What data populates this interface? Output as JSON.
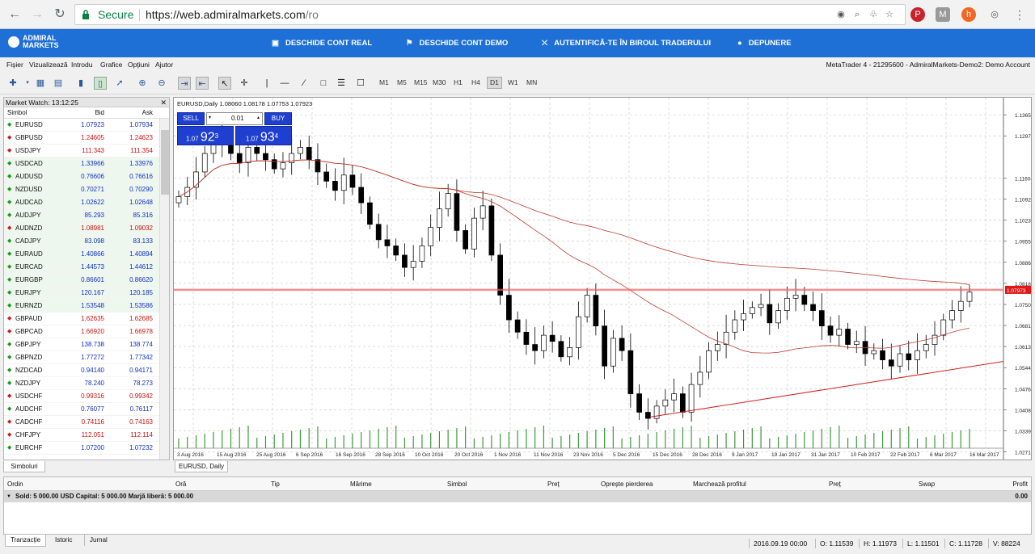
{
  "browser": {
    "secure_label": "Secure",
    "url_main": "https://web.admiralmarkets.com",
    "url_path": "/ro"
  },
  "brand": {
    "logo_line1": "ADMIRAL",
    "logo_line2": "MARKETS",
    "nav": [
      {
        "label": "DESCHIDE CONT REAL"
      },
      {
        "label": "DESCHIDE CONT DEMO"
      },
      {
        "label": "AUTENTIFICĂ-TE ÎN BIROUL TRADERULUI"
      },
      {
        "label": "DEPUNERE"
      }
    ]
  },
  "menu": {
    "items": [
      "Fișier",
      "Vizualizează",
      "Introdu",
      "Grafice",
      "Opțiuni",
      "Ajutor"
    ],
    "account": "MetaTrader 4 - 21295600 - AdmiralMarkets-Demo2: Demo Account"
  },
  "toolbar": {
    "timeframes": [
      "M1",
      "M5",
      "M15",
      "M30",
      "H1",
      "H4",
      "D1",
      "W1",
      "MN"
    ],
    "active_timeframe": "D1"
  },
  "market_watch": {
    "title": "Market Watch: 13:12:25",
    "col_symbol": "Simbol",
    "col_bid": "Bid",
    "col_ask": "Ask",
    "tab": "Simboluri",
    "colors": {
      "up": "#1a9a1a",
      "down": "#d01818",
      "blue": "#1030c0",
      "red": "#cc1010"
    },
    "rows": [
      {
        "symbol": "EURUSD",
        "bid": "1.07923",
        "ask": "1.07934",
        "dir": "up"
      },
      {
        "symbol": "GBPUSD",
        "bid": "1.24605",
        "ask": "1.24623",
        "dir": "down"
      },
      {
        "symbol": "USDJPY",
        "bid": "111.343",
        "ask": "111.354",
        "dir": "down"
      },
      {
        "symbol": "USDCAD",
        "bid": "1.33966",
        "ask": "1.33976",
        "dir": "up"
      },
      {
        "symbol": "AUDUSD",
        "bid": "0.76606",
        "ask": "0.76616",
        "dir": "up"
      },
      {
        "symbol": "NZDUSD",
        "bid": "0.70271",
        "ask": "0.70290",
        "dir": "up"
      },
      {
        "symbol": "AUDCAD",
        "bid": "1.02622",
        "ask": "1.02648",
        "dir": "up"
      },
      {
        "symbol": "AUDJPY",
        "bid": "85.293",
        "ask": "85.316",
        "dir": "up"
      },
      {
        "symbol": "AUDNZD",
        "bid": "1.08981",
        "ask": "1.09032",
        "dir": "down"
      },
      {
        "symbol": "CADJPY",
        "bid": "83.098",
        "ask": "83.133",
        "dir": "up"
      },
      {
        "symbol": "EURAUD",
        "bid": "1.40866",
        "ask": "1.40894",
        "dir": "up"
      },
      {
        "symbol": "EURCAD",
        "bid": "1.44573",
        "ask": "1.44612",
        "dir": "up"
      },
      {
        "symbol": "EURGBP",
        "bid": "0.86601",
        "ask": "0.86620",
        "dir": "up"
      },
      {
        "symbol": "EURJPY",
        "bid": "120.167",
        "ask": "120.185",
        "dir": "up"
      },
      {
        "symbol": "EURNZD",
        "bid": "1.53548",
        "ask": "1.53586",
        "dir": "up"
      },
      {
        "symbol": "GBPAUD",
        "bid": "1.62635",
        "ask": "1.62685",
        "dir": "down"
      },
      {
        "symbol": "GBPCAD",
        "bid": "1.66920",
        "ask": "1.66978",
        "dir": "down"
      },
      {
        "symbol": "GBPJPY",
        "bid": "138.738",
        "ask": "138.774",
        "dir": "up"
      },
      {
        "symbol": "GBPNZD",
        "bid": "1.77272",
        "ask": "1.77342",
        "dir": "up"
      },
      {
        "symbol": "NZDCAD",
        "bid": "0.94140",
        "ask": "0.94171",
        "dir": "up"
      },
      {
        "symbol": "NZDJPY",
        "bid": "78.240",
        "ask": "78.273",
        "dir": "up"
      },
      {
        "symbol": "USDCHF",
        "bid": "0.99316",
        "ask": "0.99342",
        "dir": "down"
      },
      {
        "symbol": "AUDCHF",
        "bid": "0.76077",
        "ask": "0.76117",
        "dir": "up"
      },
      {
        "symbol": "CADCHF",
        "bid": "0.74116",
        "ask": "0.74163",
        "dir": "down"
      },
      {
        "symbol": "CHFJPY",
        "bid": "112.051",
        "ask": "112.114",
        "dir": "down"
      },
      {
        "symbol": "EURCHF",
        "bid": "1.07200",
        "ask": "1.07232",
        "dir": "up"
      }
    ]
  },
  "chart": {
    "header": "EURUSD,Daily  1.08060 1.08178 1.07753 1.07923",
    "tab": "EURUSD, Daily",
    "one_click": {
      "sell": "SELL",
      "buy": "BUY",
      "volume": "0.01",
      "sell_big": "1.07",
      "sell_price": "92",
      "sell_sup": "3",
      "buy_big": "1.07",
      "buy_price": "93",
      "buy_sup": "4"
    },
    "current_price_label": "1.07973"
  },
  "chart_data": {
    "type": "candlestick",
    "symbol": "EURUSD",
    "timeframe": "Daily",
    "ylim": [
      1.032,
      1.14
    ],
    "y_ticks": [
      "1.13656",
      "1.12972",
      "1.11604",
      "1.10920",
      "1.10236",
      "1.09551",
      "1.08868",
      "1.08185",
      "1.07501",
      "1.06817",
      "1.06133",
      "1.05449",
      "1.04765",
      "1.04081",
      "1.03397",
      "1.02713"
    ],
    "x_ticks": [
      "3 Aug 2016",
      "15 Aug 2016",
      "25 Aug 2016",
      "6 Sep 2016",
      "16 Sep 2016",
      "28 Sep 2016",
      "10 Oct 2016",
      "20 Oct 2016",
      "1 Nov 2016",
      "11 Nov 2016",
      "23 Nov 2016",
      "5 Dec 2016",
      "15 Dec 2016",
      "28 Dec 2016",
      "9 Jan 2017",
      "19 Jan 2017",
      "31 Jan 2017",
      "10 Feb 2017",
      "22 Feb 2017",
      "6 Mar 2017",
      "16 Mar 2017"
    ],
    "close_path": [
      1.11,
      1.113,
      1.118,
      1.124,
      1.129,
      1.127,
      1.124,
      1.121,
      1.126,
      1.124,
      1.122,
      1.119,
      1.121,
      1.124,
      1.126,
      1.122,
      1.118,
      1.115,
      1.112,
      1.117,
      1.113,
      1.108,
      1.101,
      1.096,
      1.094,
      1.091,
      1.087,
      1.089,
      1.094,
      1.1,
      1.106,
      1.111,
      1.099,
      1.093,
      1.103,
      1.107,
      1.091,
      1.078,
      1.07,
      1.066,
      1.062,
      1.06,
      1.065,
      1.063,
      1.058,
      1.061,
      1.071,
      1.078,
      1.068,
      1.055,
      1.064,
      1.06,
      1.046,
      1.04,
      1.038,
      1.042,
      1.044,
      1.046,
      1.04,
      1.049,
      1.053,
      1.06,
      1.062,
      1.066,
      1.07,
      1.072,
      1.074,
      1.075,
      1.069,
      1.073,
      1.077,
      1.078,
      1.075,
      1.073,
      1.068,
      1.065,
      1.067,
      1.062,
      1.063,
      1.059,
      1.06,
      1.057,
      1.055,
      1.059,
      1.057,
      1.06,
      1.062,
      1.065,
      1.07,
      1.073,
      1.076,
      1.079
    ]
  },
  "trade": {
    "columns": [
      "Ordin",
      "Oră",
      "Tip",
      "Mărime",
      "Simbol",
      "Preț",
      "Oprește pierderea",
      "Marchează profitul",
      "Preț",
      "Swap",
      "Profit"
    ],
    "balance": "Sold: 5 000.00 USD  Capital: 5 000.00  Marjă liberă: 5 000.00",
    "profit": "0.00",
    "tabs": [
      "Tranzacție",
      "Istoric",
      "Jurnal"
    ]
  },
  "status": {
    "date": "2016.09.19 00:00",
    "open": "O: 1.11539",
    "high": "H: 1.11973",
    "low": "L: 1.11501",
    "close": "C: 1.11728",
    "volume": "V: 88224"
  }
}
